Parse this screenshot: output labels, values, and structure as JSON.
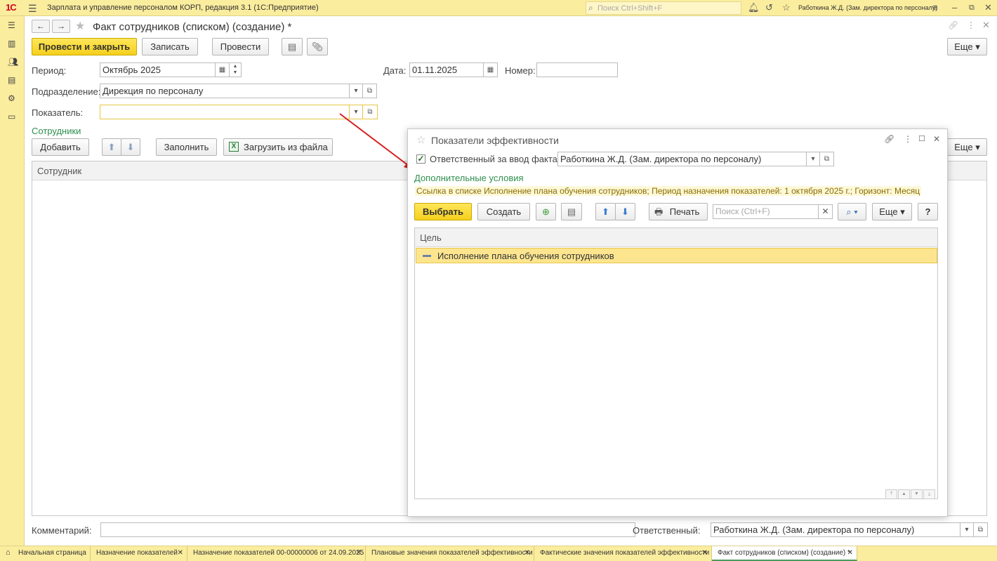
{
  "app": {
    "logo": "1С",
    "title": "Зарплата и управление персоналом КОРП, редакция 3.1  (1С:Предприятие)",
    "search_placeholder": "Поиск Ctrl+Shift+F",
    "user": "Работкина Ж.Д. (Зам. директора по персоналу)"
  },
  "form": {
    "title": "Факт сотрудников (списком) (создание) *",
    "toolbar": {
      "post_close": "Провести и закрыть",
      "save": "Записать",
      "post": "Провести",
      "more": "Еще"
    },
    "fields": {
      "period_label": "Период:",
      "period_value": "Октябрь 2025",
      "date_label": "Дата:",
      "date_value": "01.11.2025",
      "number_label": "Номер:",
      "number_value": "",
      "department_label": "Подразделение:",
      "department_value": "Дирекция по персоналу",
      "indicator_label": "Показатель:",
      "indicator_value": ""
    },
    "employees": {
      "section_title": "Сотрудники",
      "add": "Добавить",
      "fill": "Заполнить",
      "load_file": "Загрузить из файла",
      "more": "Еще",
      "column_employee": "Сотрудник"
    },
    "footer": {
      "comment_label": "Комментарий:",
      "comment_value": "",
      "responsible_label": "Ответственный:",
      "responsible_value": "Работкина Ж.Д. (Зам. директора по персоналу)"
    }
  },
  "popup": {
    "title": "Показатели эффективности",
    "responsible_check_label": "Ответственный за ввод факта",
    "responsible_checked": true,
    "responsible_value": "Работкина Ж.Д. (Зам. директора по персоналу)",
    "conditions_title": "Дополнительные условия",
    "conditions_text": "Ссылка в списке Исполнение плана обучения сотрудников; Период назначения показателей: 1 октября 2025 г.; Горизонт: Месяц",
    "select": "Выбрать",
    "create": "Создать",
    "print": "Печать",
    "search_placeholder": "Поиск (Ctrl+F)",
    "more": "Еще",
    "help": "?",
    "column_goal": "Цель",
    "rows": [
      "Исполнение плана обучения сотрудников"
    ]
  },
  "taskbar": {
    "home": "Начальная страница",
    "tabs": [
      "Назначение показателей",
      "Назначение показателей 00-00000006 от 24.09.2025",
      "Плановые значения показателей эффективности",
      "Фактические значения показателей эффективности",
      "Факт сотрудников (списком) (создание) *"
    ]
  },
  "colors": {
    "accent_yellow": "#fbed9e",
    "primary_button": "#f5cf1c",
    "section_green": "#2f8f4e",
    "arrow_red": "#d42020"
  }
}
